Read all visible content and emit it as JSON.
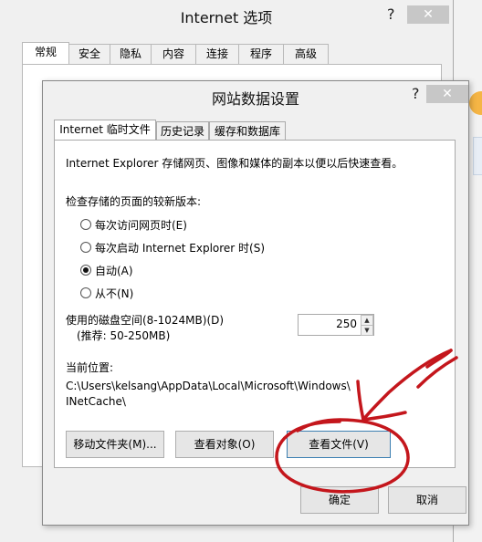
{
  "outer_dialog": {
    "title": "Internet 选项",
    "help": "?",
    "close": "✕",
    "tabs": [
      "常规",
      "安全",
      "隐私",
      "内容",
      "连接",
      "程序",
      "高级"
    ]
  },
  "inner_dialog": {
    "title": "网站数据设置",
    "help": "?",
    "close": "✕",
    "tabs": [
      "Internet 临时文件",
      "历史记录",
      "缓存和数据库"
    ],
    "description": "Internet Explorer 存储网页、图像和媒体的副本以便以后快速查看。",
    "check_label": "检查存储的页面的较新版本:",
    "options": [
      {
        "label": "每次访问网页时(E)",
        "checked": false
      },
      {
        "label": "每次启动 Internet Explorer 时(S)",
        "checked": false
      },
      {
        "label": "自动(A)",
        "checked": true
      },
      {
        "label": "从不(N)",
        "checked": false
      }
    ],
    "disk_label": "使用的磁盘空间(8-1024MB)(D)",
    "disk_recommend": "(推荐: 50-250MB)",
    "disk_value": "250",
    "location_label": "当前位置:",
    "location_line1": "C:\\Users\\kelsang\\AppData\\Local\\Microsoft\\Windows\\",
    "location_line2": "INetCache\\",
    "buttons": {
      "move_folder": "移动文件夹(M)...",
      "view_objects": "查看对象(O)",
      "view_files": "查看文件(V)"
    },
    "ok": "确定",
    "cancel": "取消"
  },
  "colors": {
    "annotation": "#c4161c",
    "dialog_bg": "#f0f0f0",
    "close_bg": "#c7c7c7"
  }
}
